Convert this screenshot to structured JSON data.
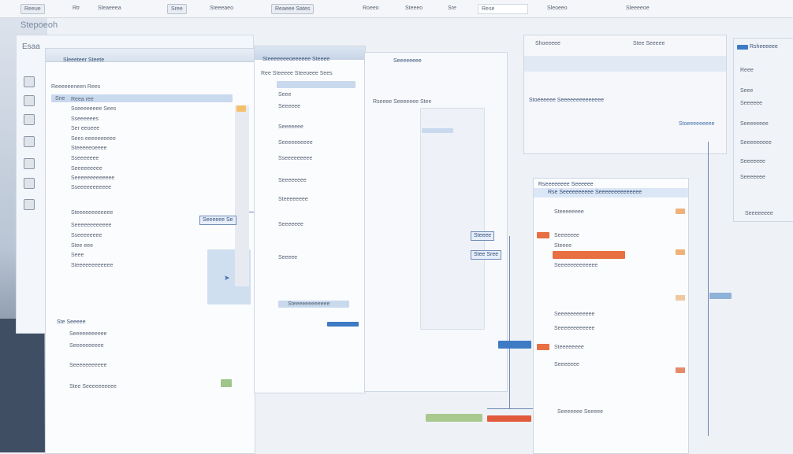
{
  "menubar": {
    "items": [
      "Reeue",
      "Rtr",
      "Sleaeeea",
      "Sree",
      "Steeeaeo",
      "Reaeee Sates",
      "Roeeo",
      "Steeeo",
      "Sre",
      "Rese",
      "Sleoeeo",
      "Sleeeeoe"
    ]
  },
  "window": {
    "title": "Stepoeoh"
  },
  "left_panel": {
    "title": "Esaa",
    "header": "Sleeeteer Steete",
    "subheader": "Reeeeeeneen Rees",
    "column": "Sne",
    "rows": [
      "Reea ree",
      "Sseeeeeeee Sees",
      "Sseeeeees",
      "Ser eeoeee",
      "Sees eeeeeeeeee",
      "Steeeeeoeeee",
      "Sseeeeeee",
      "Seeeeeeeee",
      "Seeeeeeeeeeeee",
      "Sseeeeeeeeeee",
      "Steeeeeeeeeeee",
      "Seeeeeeeeeeee",
      "Sseeeeeeee",
      "Stee eee",
      "Seee",
      "Steeeeeeeeeeee"
    ],
    "second_header": "Ste Seeeee",
    "second_rows": [
      "Seeeeeeeeeee",
      "Seeeeeeeeee",
      "Seeeeeeeeeee",
      "Stee Seeeeeeeeee"
    ],
    "callout": "Seeeeee Se"
  },
  "middle_panel": {
    "tab": "Steeeeeeeoeeeeee Steeee",
    "header": "Ree Steeeee Steeoeee Sees",
    "items": [
      "Seee",
      "Seeeeee",
      "Seeeeeee",
      "Seeeeeeeeee",
      "Sseeeeeeeee",
      "Seeeeeeee",
      "Steeeeeeee",
      "Seeeeeee",
      "Seeeee"
    ],
    "footer": "Steeeeeeeeeeee"
  },
  "center_panel": {
    "title": "Seeeeeeee",
    "label": "Rseeee Seeeeeee Stee",
    "tags": [
      "Steeee",
      "Stee Sree"
    ]
  },
  "right_panel": {
    "header": "Shoeeeee",
    "subheader": "Stee Seeeee",
    "title": "Stoeeeeee Seeeeeeeeeeeeee",
    "link": "Stoeeeeeeeee",
    "dialog_title": "Rseeeeeeee Seeeeee",
    "dialog_subtitle": "Rse Seeeeeeeeee Seeeeeeeeeeeeee",
    "items": [
      "Steeeeeeee",
      "Seeeeeee",
      "Steeee",
      "Seeeeeeeeeeeee",
      "Seeeeeeeeeeee",
      "Seeeeeeeeeeee",
      "Steeeeeeee",
      "Seeeeeee"
    ],
    "footer": "Seeeeeee Seeeee"
  },
  "sidebar": {
    "title": "Rsheeeeee",
    "items": [
      "Reee",
      "Seee",
      "Seeeeee",
      "Seeeeeeee",
      "Seeeeeeeee",
      "Seeeeeee",
      "Seeeeeee"
    ],
    "footer": "Seeeeeeee"
  },
  "colors": {
    "accent_blue": "#3f7bc4",
    "accent_orange": "#e76f42",
    "sidebar_dark": "#3f4e63"
  }
}
